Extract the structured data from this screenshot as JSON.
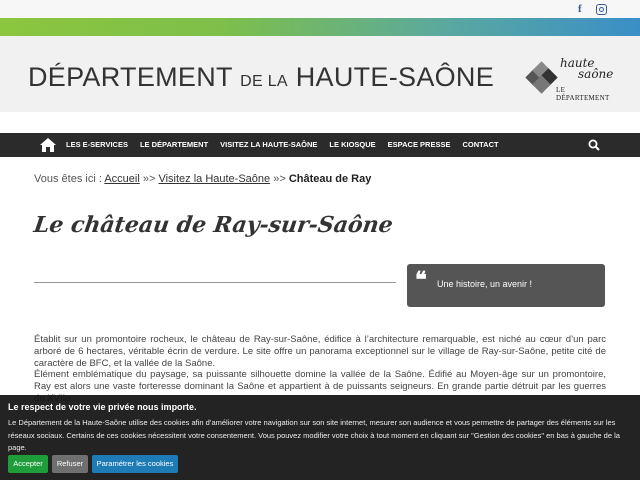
{
  "social": {
    "facebook_icon": "f",
    "instagram_icon": "instagram-icon"
  },
  "header": {
    "title_part1": "DÉPARTEMENT",
    "title_part2": "DE LA",
    "title_part3": "HAUTE-SAÔNE",
    "logo_line1": "haute",
    "logo_line2": "saône",
    "logo_line3": "LE DÉPARTEMENT"
  },
  "nav": {
    "items": [
      "LES E-SERVICES",
      "LE DÉPARTEMENT",
      "VISITEZ LA HAUTE-SAÔNE",
      "LE KIOSQUE",
      "ESPACE PRESSE",
      "CONTACT"
    ]
  },
  "breadcrumb": {
    "prefix": "Vous êtes ici : ",
    "home": "Accueil",
    "sep": " »> ",
    "section": "Visitez la Haute-Saône",
    "current": "Château de Ray"
  },
  "page": {
    "heading": "Le château de Ray-sur-Saône",
    "quote": "Une histoire, un avenir !",
    "paragraph1": "Établit sur un promontoire rocheux, le château de Ray-sur-Saône, édifice à l’architecture remarquable, est niché au cœur d’un parc arboré de 6 hectares, véritable écrin de verdure. Le site offre un panorama exceptionnel sur le village de Ray-sur-Saône, petite cité de caractère de BFC, et la vallée de la Saône.",
    "paragraph2": "Élément emblématique du paysage, sa puissante silhouette domine la vallée de la Saône. Édifié au Moyen-âge sur un promontoire, Ray est alors une vaste forteresse dominant la Saône et appartient à de puissants seigneurs. En grande partie détruit par les guerres du XVIIe"
  },
  "cookie": {
    "title": "Le respect de votre vie privée nous importe.",
    "text": "Le Département de la Haute-Saône utilise des cookies afin d’améliorer votre navigation sur son site internet, mesurer son audience et vous permettre de partager des éléments sur les réseaux sociaux. Certains de ces cookies nécessitent votre consentement. Vous pouvez modifier votre choix à tout moment en cliquant sur \"Gestion des cookies\" en bas à gauche de la page.",
    "accept": "Accepter",
    "refuse": "Refuser",
    "settings": "Paramétrer les cookies"
  },
  "colors": {
    "nav_bg": "#2b2b2b",
    "quote_bg": "#555555",
    "accept": "#1f9d3a",
    "refuse": "#6f6f6f",
    "settings": "#1f7bb6"
  }
}
